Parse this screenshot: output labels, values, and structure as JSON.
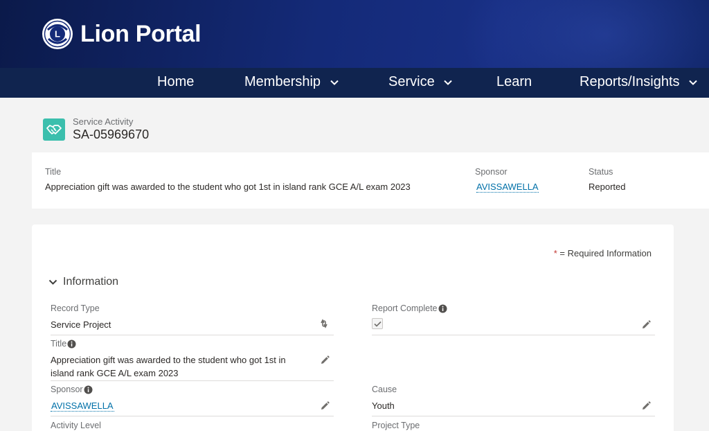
{
  "app": {
    "title": "Lion Portal",
    "logo_icon": "lions-international-logo"
  },
  "nav": {
    "items": [
      {
        "label": "Home",
        "has_dropdown": false
      },
      {
        "label": "Membership",
        "has_dropdown": true
      },
      {
        "label": "Service",
        "has_dropdown": true
      },
      {
        "label": "Learn",
        "has_dropdown": false
      },
      {
        "label": "Reports/Insights",
        "has_dropdown": true
      }
    ]
  },
  "record": {
    "object_label": "Service Activity",
    "number": "SA-05969670",
    "icon": "handshake-icon"
  },
  "highlights": {
    "title_label": "Title",
    "title_value": "Appreciation gift was awarded to the student who got 1st in island rank GCE A/L exam 2023",
    "sponsor_label": "Sponsor",
    "sponsor_value": "AVISSAWELLA",
    "status_label": "Status",
    "status_value": "Reported"
  },
  "details": {
    "required_star": "*",
    "required_text": " = Required Information",
    "section_title": "Information",
    "fields": {
      "record_type": {
        "label": "Record Type",
        "value": "Service Project"
      },
      "report_complete": {
        "label": "Report Complete",
        "checked": true
      },
      "title": {
        "label": "Title",
        "value_line1": "Appreciation gift was awarded to the student who got 1st in",
        "value_line2": "island rank GCE A/L exam 2023"
      },
      "sponsor": {
        "label": "Sponsor",
        "value": "AVISSAWELLA"
      },
      "cause": {
        "label": "Cause",
        "value": "Youth"
      },
      "activity_level": {
        "label": "Activity Level"
      },
      "project_type": {
        "label": "Project Type"
      }
    }
  },
  "colors": {
    "banner": "#142a78",
    "nav": "#10244f",
    "record_icon": "#3bbfad",
    "link": "#0070a8",
    "required": "#c23934"
  }
}
